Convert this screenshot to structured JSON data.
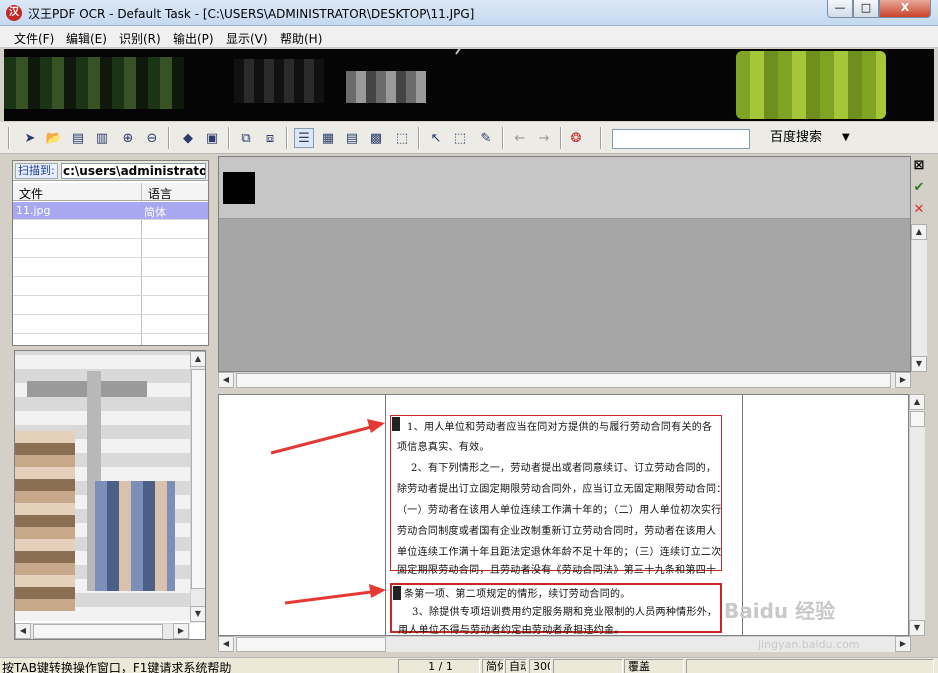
{
  "window": {
    "title": "汉王PDF OCR - Default Task - [C:\\USERS\\ADMINISTRATOR\\DESKTOP\\11.JPG]",
    "min_glyph": "—",
    "max_glyph": "□",
    "close_glyph": "X"
  },
  "menu": [
    "文件(F)",
    "编辑(E)",
    "识别(R)",
    "输出(P)",
    "显示(V)",
    "帮助(H)"
  ],
  "toolbar": {
    "search_placeholder": "",
    "search_button": "百度搜索"
  },
  "left_panel": {
    "scan_label": "扫描到:",
    "scan_path": "c:\\users\\administrator\\",
    "columns": [
      "文件",
      "语言"
    ],
    "rows": [
      {
        "file": "11.jpg",
        "lang": "简体"
      }
    ]
  },
  "document": {
    "block1": [
      "1、用人单位和劳动者应当在同对方提供的与履行劳动合同有关的各",
      "项信息真实、有效。",
      "2、有下列情形之一，劳动者提出或者同意续订、订立劳动合同的，",
      "除劳动者提出订立固定期限劳动合同外，应当订立无固定期限劳动合同：",
      "（一）劳动者在该用人单位连续工作满十年的；（二）用人单位初次实行",
      "劳动合同制度或者国有企业改制重新订立劳动合同时，劳动者在该用人",
      "单位连续工作满十年且距法定退休年龄不足十年的；（三）连续订立二次",
      "固定期限劳动合同，且劳动者没有《劳动合同法》第三十九条和第四十"
    ],
    "block2": [
      "条第一项、第二项规定的情形，续订劳动合同的。",
      "3、除提供专项培训费用约定服务期和竞业限制的人员两种情形外，",
      "用人单位不得与劳动者约定由劳动者承担违约金。"
    ]
  },
  "status": {
    "hint": "按TAB键转换操作窗口，F1键请求系统帮助",
    "page": "1 / 1",
    "lang": "简体",
    "mode": "自动",
    "dpi": "300",
    "insert": "覆盖"
  },
  "watermark": "Baidu 经验",
  "watermark_url": "jingyan.baidu.com"
}
